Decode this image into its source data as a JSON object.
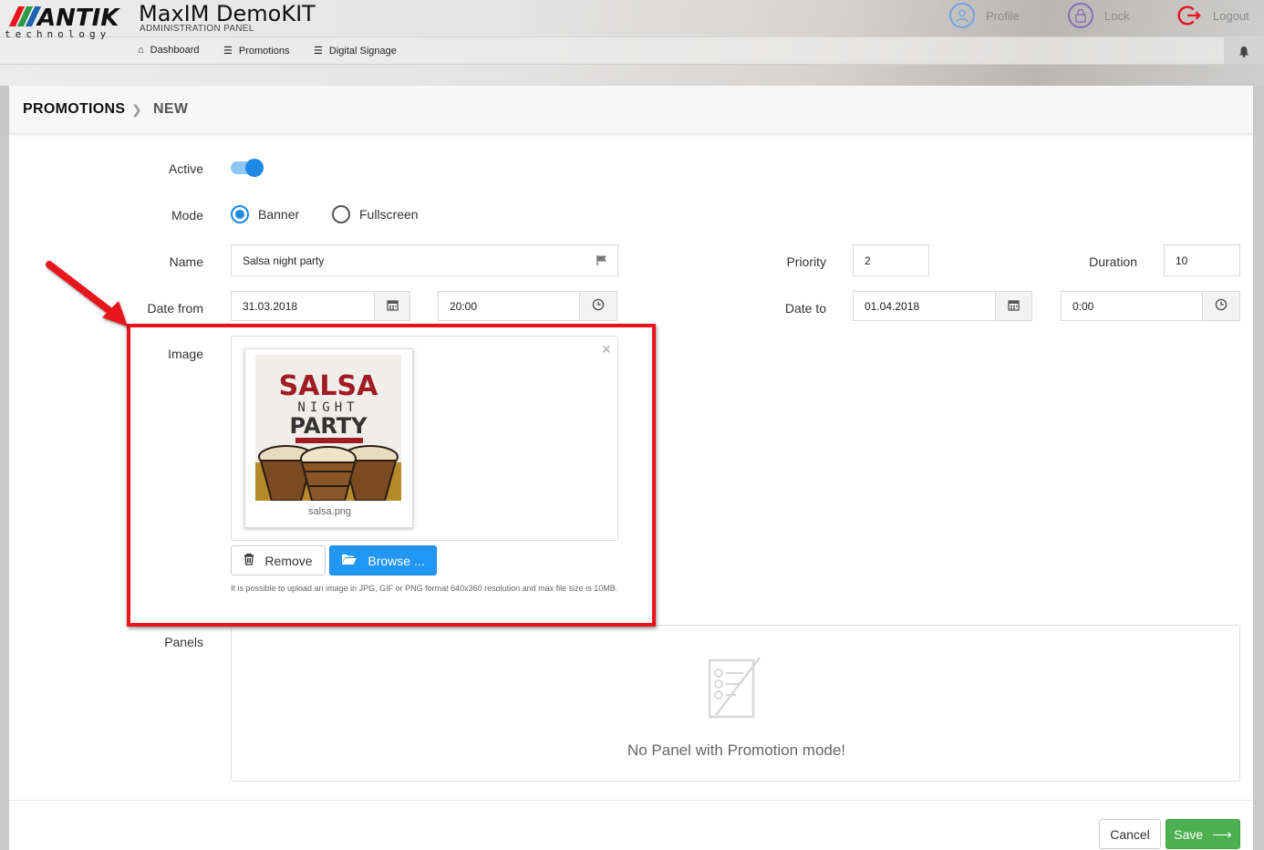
{
  "brand": {
    "logo_text": "ANTIK",
    "logo_subtext": "technology",
    "app_title": "MaxIM DemoKIT",
    "app_subtitle": "ADMINISTRATION PANEL",
    "logo_colors": [
      "#e8131b",
      "#2e9b45",
      "#1f64b0"
    ]
  },
  "top_links": [
    {
      "label": "Profile",
      "icon": "user-icon",
      "color": "#6ea5e6"
    },
    {
      "label": "Lock",
      "icon": "lock-icon",
      "color": "#8a6db7"
    },
    {
      "label": "Logout",
      "icon": "logout-icon",
      "color": "#e8131b"
    }
  ],
  "nav": [
    {
      "label": "Dashboard",
      "icon": "home-icon"
    },
    {
      "label": "Promotions",
      "icon": "list-icon"
    },
    {
      "label": "Digital Signage",
      "icon": "list-icon"
    }
  ],
  "breadcrumb": {
    "section": "PROMOTIONS",
    "page": "NEW"
  },
  "form": {
    "active": {
      "label": "Active",
      "value": true
    },
    "mode": {
      "label": "Mode",
      "options": [
        "Banner",
        "Fullscreen"
      ],
      "selected": "Banner"
    },
    "name": {
      "label": "Name",
      "value": "Salsa night party"
    },
    "priority": {
      "label": "Priority",
      "value": "2"
    },
    "duration": {
      "label": "Duration",
      "value": "10"
    },
    "date_from": {
      "label": "Date from",
      "date": "31.03.2018",
      "time": "20:00"
    },
    "date_to": {
      "label": "Date to",
      "date": "01.04.2018",
      "time": "0:00"
    },
    "image": {
      "label": "Image",
      "file_name": "salsa.png",
      "thumb_text": {
        "line1": "SALSA",
        "line2": "NIGHT",
        "line3": "PARTY"
      },
      "remove_label": "Remove",
      "browse_label": "Browse ...",
      "hint": "It is possible to upload an image in JPG, GIF or PNG format 640x360 resolution and max file size is 10MB."
    },
    "panels": {
      "label": "Panels",
      "empty_message": "No Panel with Promotion mode!"
    }
  },
  "actions": {
    "cancel_label": "Cancel",
    "save_label": "Save"
  },
  "colors": {
    "primary": "#2196f3",
    "success": "#4caf50",
    "annotation": "#e8131b"
  }
}
